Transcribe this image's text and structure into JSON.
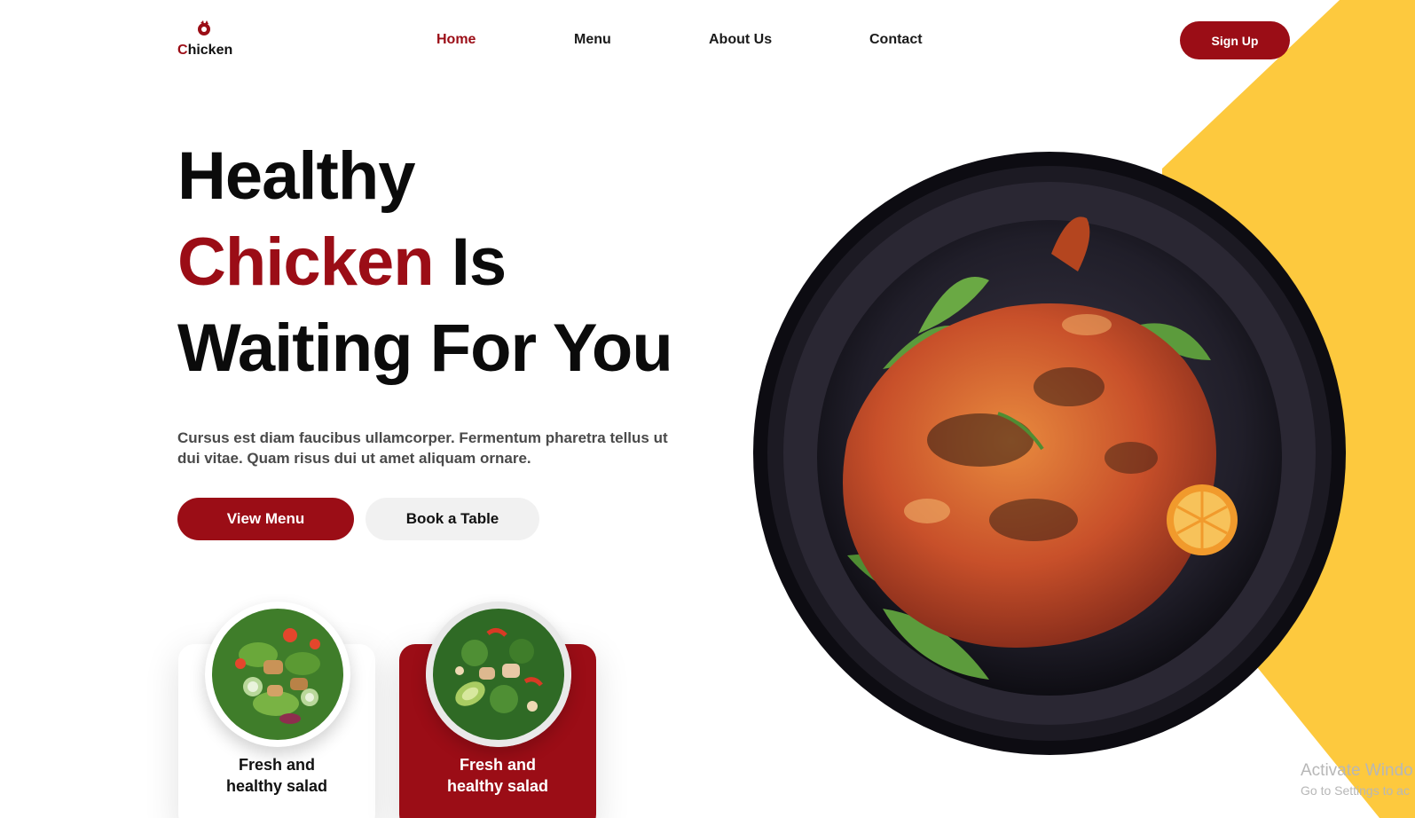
{
  "logo": {
    "first_letter": "C",
    "rest": "hicken"
  },
  "nav": {
    "items": [
      "Home",
      "Menu",
      "About Us",
      "Contact"
    ]
  },
  "signup_label": "Sign Up",
  "hero": {
    "line1": "Healthy",
    "line2_accent": "Chicken",
    "line2_rest": " Is",
    "line3": "Waiting For You",
    "description": "Cursus est diam faucibus ullamcorper. Fermentum pharetra tellus ut dui vitae. Quam risus dui ut amet aliquam ornare."
  },
  "buttons": {
    "view_menu": "View Menu",
    "book_table": "Book a Table"
  },
  "cards": [
    {
      "title_line1": "Fresh and",
      "title_line2": "healthy salad",
      "subtitle": ""
    },
    {
      "title_line1": "Fresh and",
      "title_line2": "healthy salad",
      "subtitle": ""
    }
  ],
  "watermark": {
    "line1": "Activate Windo",
    "line2": "Go to Settings to ac"
  },
  "colors": {
    "brand": "#9b0d16",
    "accent_yellow": "#fdc93e",
    "text_dark": "#0b0b0b"
  }
}
